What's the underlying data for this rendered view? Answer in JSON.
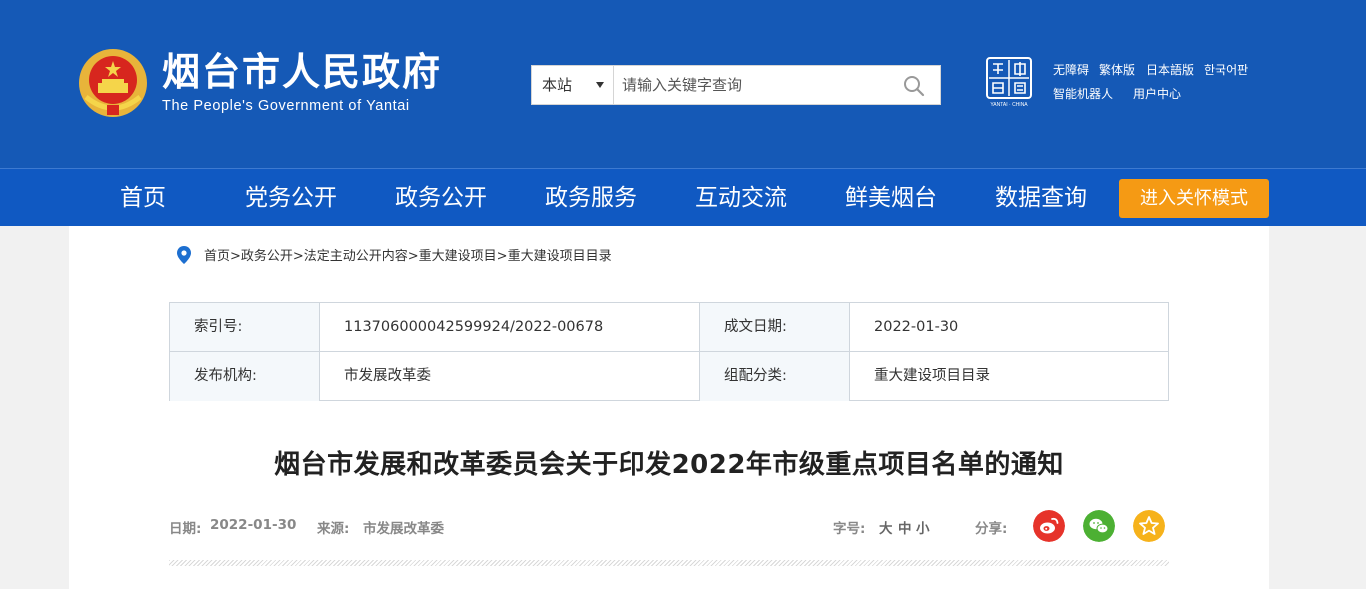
{
  "header": {
    "title": "烟台市人民政府",
    "subtitle": "The People's Government of Yantai",
    "search": {
      "scope": "本站",
      "placeholder": "请输入关键字查询"
    },
    "seal_text": "YANTAI · CHINA",
    "links": [
      "无障碍",
      "繁体版",
      "日本語版",
      "한국어판",
      "智能机器人",
      "用户中心"
    ]
  },
  "nav": {
    "items": [
      "首页",
      "党务公开",
      "政务公开",
      "政务服务",
      "互动交流",
      "鲜美烟台",
      "数据查询"
    ],
    "care_mode": "进入关怀模式"
  },
  "breadcrumb": "首页>政务公开>法定主动公开内容>重大建设项目>重大建设项目目录",
  "meta": {
    "index_label": "索引号:",
    "index_value": "113706000042599924/2022-00678",
    "date_label": "成文日期:",
    "date_value": "2022-01-30",
    "org_label": "发布机构:",
    "org_value": "市发展改革委",
    "category_label": "组配分类:",
    "category_value": "重大建设项目目录"
  },
  "article": {
    "title": "烟台市发展和改革委员会关于印发2022年市级重点项目名单的通知",
    "date_label": "日期:",
    "date": "2022-01-30",
    "source_label": "来源:",
    "source": "市发展改革委",
    "font_label": "字号:",
    "font_large": "大",
    "font_medium": "中",
    "font_small": "小",
    "share_label": "分享:"
  },
  "colors": {
    "header_bg": "#1559b6",
    "nav_bg": "#1059c2",
    "care_button": "#f59a14",
    "weibo": "#e6332a",
    "wechat": "#4cb033",
    "favorite": "#f6b21b"
  }
}
